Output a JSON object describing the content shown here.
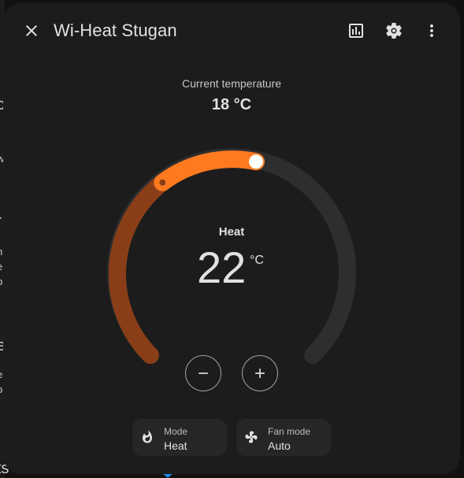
{
  "dialog": {
    "title": "Wi-Heat Stugan",
    "icons": {
      "close": "close-icon",
      "history": "chart-icon",
      "settings": "gear-icon",
      "more": "more-vert-icon"
    }
  },
  "current": {
    "label": "Current temperature",
    "value": "18 °C"
  },
  "thermostat": {
    "mode_label": "Heat",
    "target_value": "22",
    "unit": "°C",
    "colors": {
      "active": "#ff7a1f",
      "inactive_heat": "#8a3e18",
      "track": "#2e2e2e"
    }
  },
  "controls": {
    "decrease_icon": "minus-icon",
    "increase_icon": "plus-icon"
  },
  "chips": {
    "mode": {
      "label": "Mode",
      "value": "Heat",
      "icon": "fire-icon"
    },
    "fan": {
      "label": "Fan mode",
      "value": "Auto",
      "icon": "fan-auto-icon"
    }
  },
  "background": {
    "fragments": [
      "c",
      "w",
      "r",
      "n",
      "e",
      "b",
      "e",
      "e",
      "o",
      "ts"
    ]
  }
}
